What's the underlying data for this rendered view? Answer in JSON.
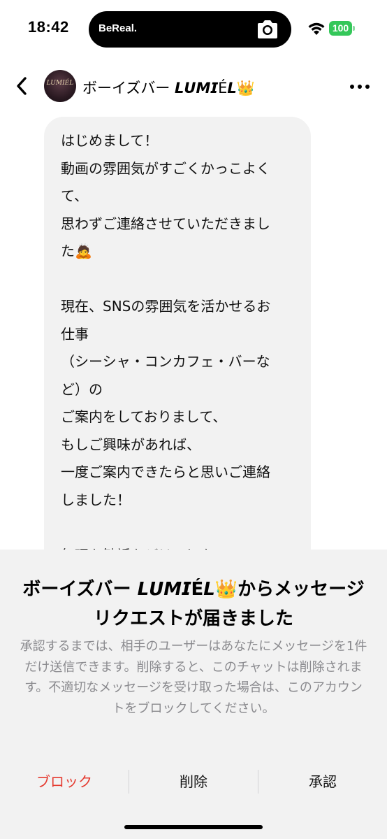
{
  "status_bar": {
    "time": "18:42",
    "island_brand": "BeReal.",
    "battery": "100",
    "icons": [
      "camera-icon",
      "wifi-icon",
      "battery-icon"
    ]
  },
  "header": {
    "avatar_text": "LUMIÉL",
    "title": "ボーイズバー 𝙇𝙐𝙈𝙄É𝙇👑",
    "icons": [
      "back-icon",
      "more-icon"
    ]
  },
  "message": {
    "lines": [
      "はじめまして！",
      "動画の雰囲気がすごくかっこよく",
      "て、",
      "思わずご連絡させていただきまし",
      "た🙇",
      "",
      "現在、SNSの雰囲気を活かせるお",
      "仕事",
      "（シーシャ・コンカフェ・バーな",
      "ど）の",
      "ご案内をしておりまして、",
      "もしご興味があれば、",
      "一度ご案内できたらと思いご連絡",
      "しました！",
      "",
      "無理な勧誘などは一切ないので、"
    ]
  },
  "request_sheet": {
    "title": "ボーイズバー 𝙇𝙐𝙈𝙄É𝙇👑からメッセージリクエストが届きました",
    "description": "承認するまでは、相手のユーザーはあなたにメッセージを1件だけ送信できます。削除すると、このチャットは削除されます。不適切なメッセージを受け取った場合は、このアカウントをブロックしてください。",
    "block_label": "ブロック",
    "delete_label": "削除",
    "accept_label": "承認"
  },
  "colors": {
    "accent_red": "#e53b30",
    "battery_green": "#34c759",
    "bubble_bg": "#f2f2f2",
    "muted_text": "#8a8a8e"
  }
}
